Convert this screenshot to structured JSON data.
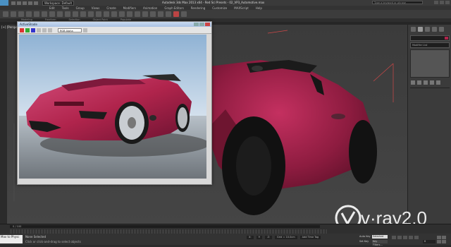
{
  "app": {
    "title": "Autodesk 3ds Max 2013 x64 - Red Sci Presets - 02_VP3_Automotive.max",
    "workspace": "Workspace: Default",
    "search_placeholder": "Type a keyword or phrase"
  },
  "menu": [
    "Edit",
    "Tools",
    "Group",
    "Views",
    "Create",
    "Modifiers",
    "Animation",
    "Graph Editors",
    "Rendering",
    "Customize",
    "MAXScript",
    "Help"
  ],
  "ribbon_tabs": [
    "Modeling",
    "Freeform",
    "Selection",
    "Object Paint",
    "Populate"
  ],
  "viewport": {
    "label": "[+] [Perspective] [Realistic]"
  },
  "right_panel": {
    "modifier_list": "Modifier List"
  },
  "vfb": {
    "title": "ActiveShade",
    "channel": "RGB Alpha"
  },
  "timeline": {
    "slider": "0 / 100"
  },
  "status": {
    "maxscript": "Max to Physc",
    "selection": "None Selected",
    "prompt": "Click or click-and-drag to select objects",
    "x": "X:",
    "y": "Y:",
    "z": "Z:",
    "grid": "Grid = 10.0cm",
    "add_time_tag": "Add Time Tag",
    "auto_key": "Auto Key",
    "auto_key_value": "Selected",
    "set_key": "Set Key",
    "key_filters": "Key Filters...",
    "frame": "0"
  },
  "logo": {
    "text": "v·ray2.0"
  },
  "colors": {
    "car": "#b0244c",
    "accent": "#4a90c2"
  }
}
